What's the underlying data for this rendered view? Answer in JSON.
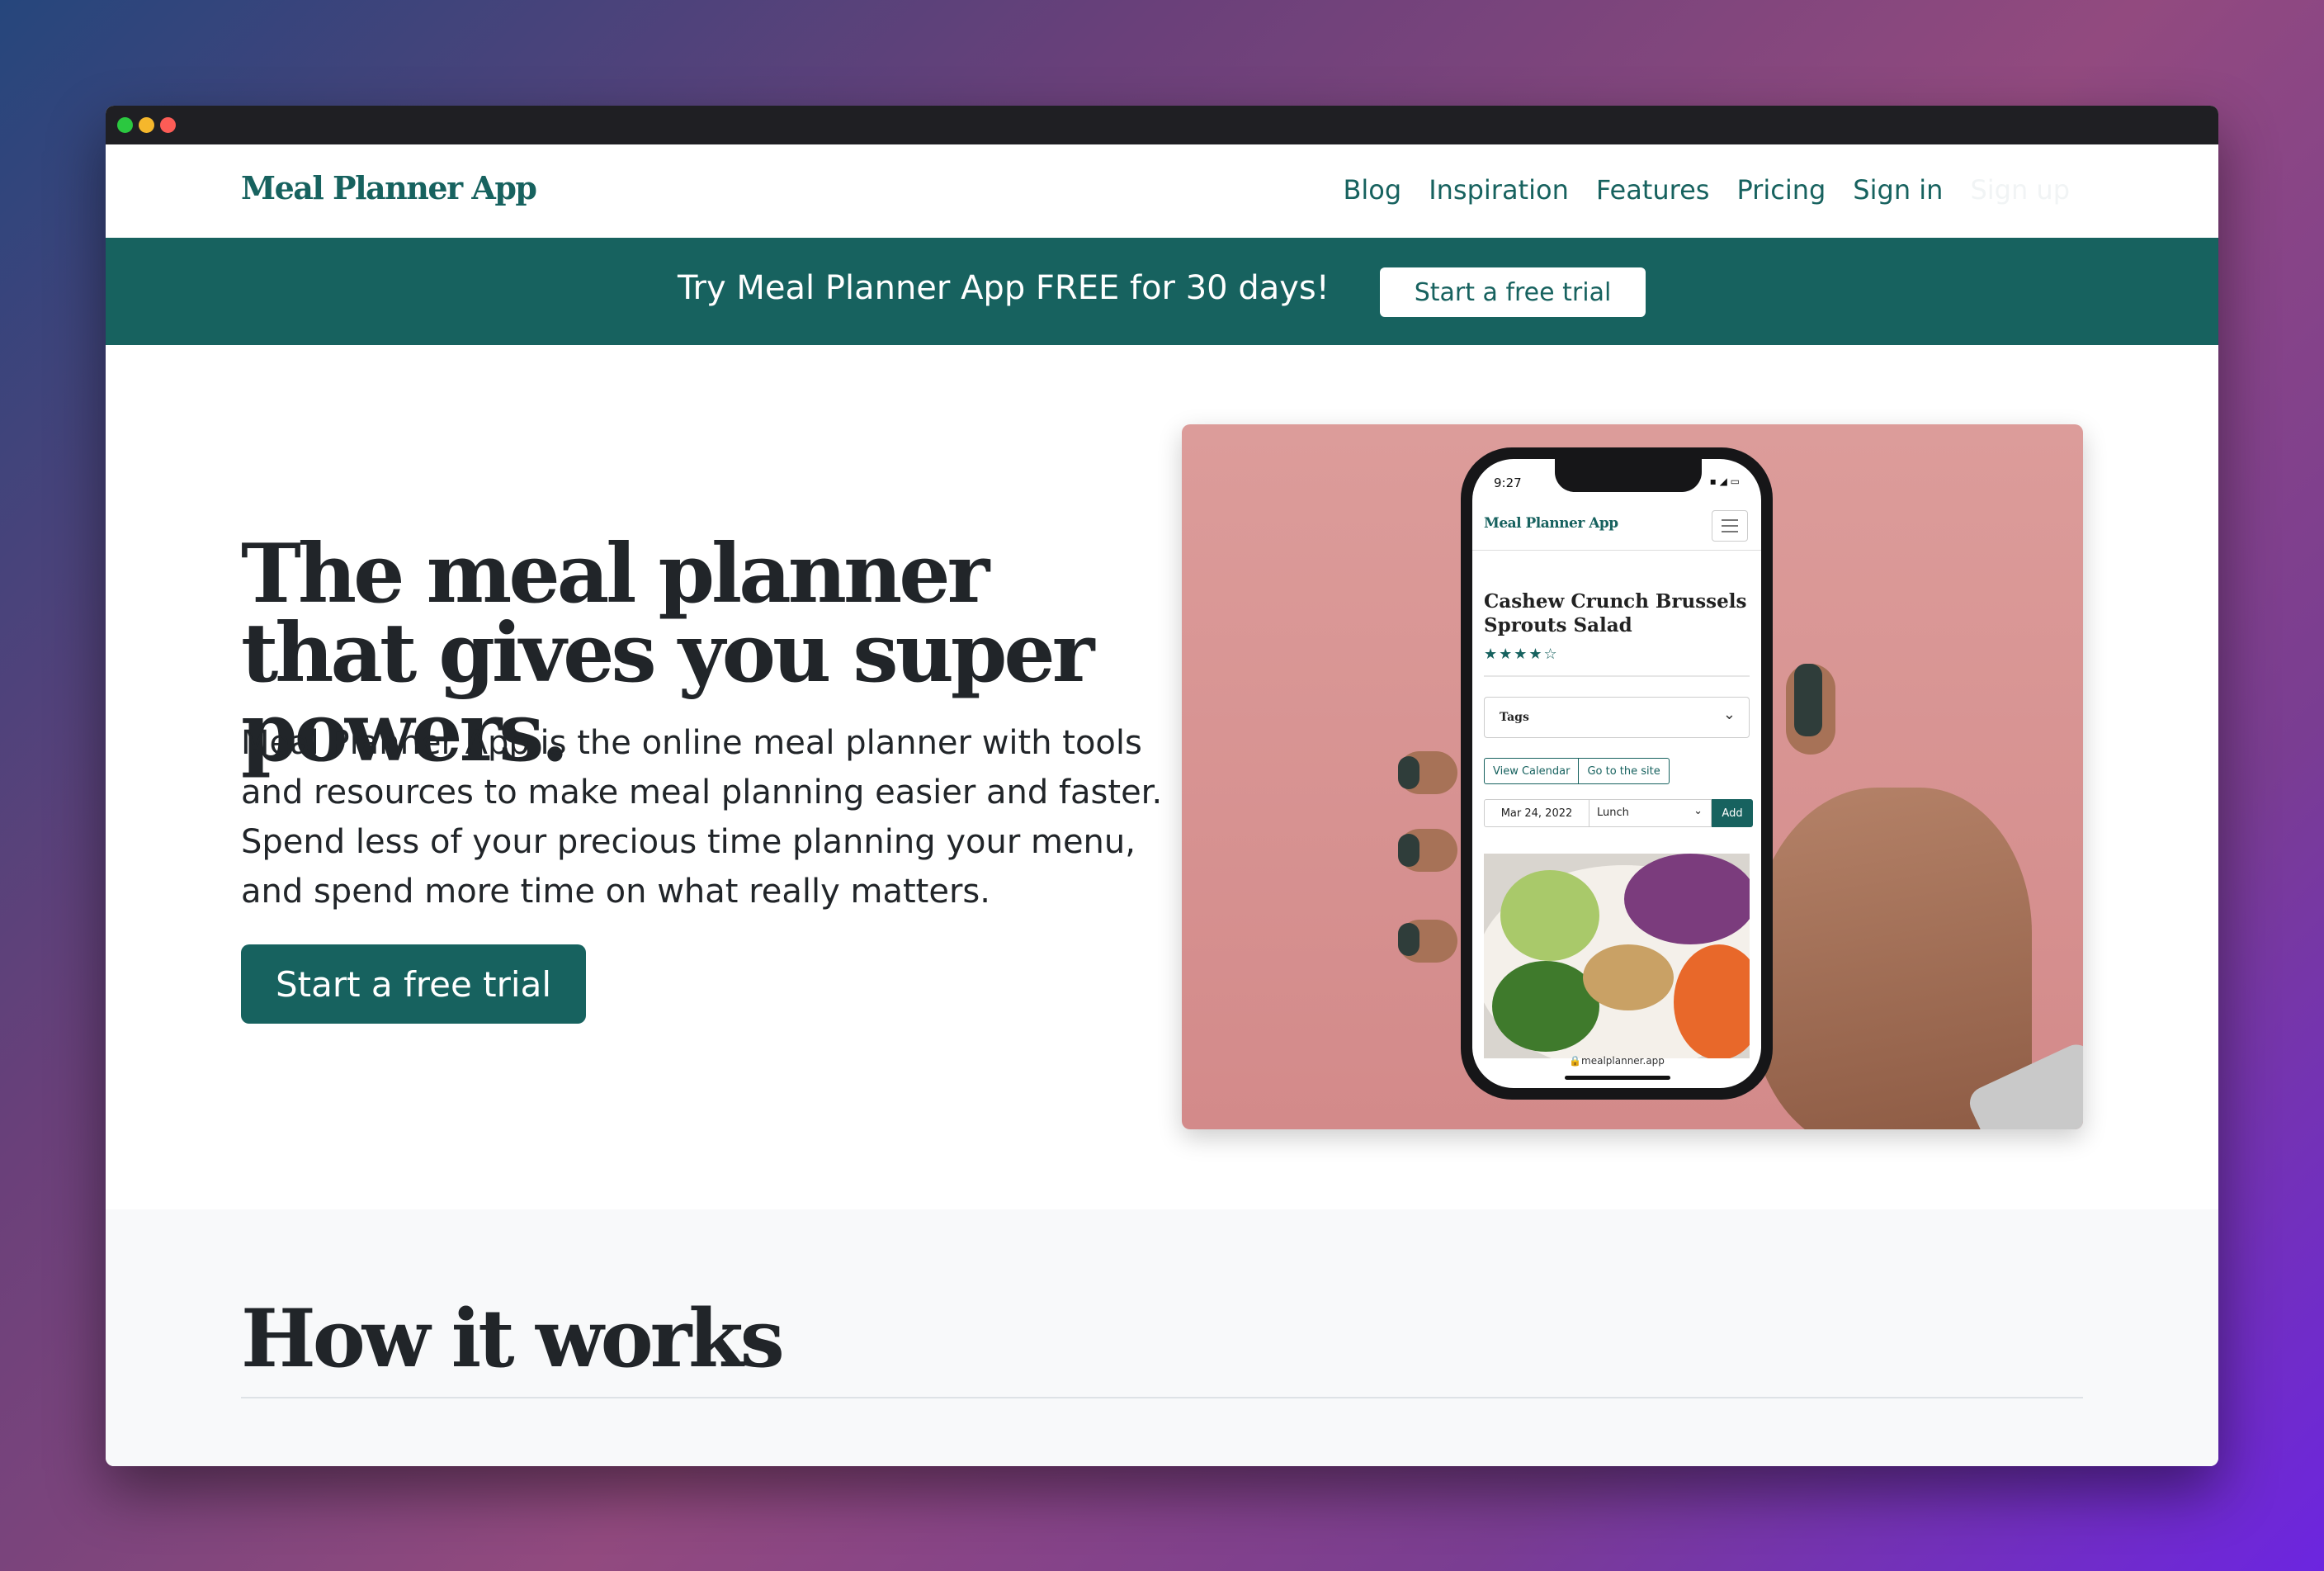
{
  "window": {
    "controls": [
      "green",
      "yellow",
      "red"
    ]
  },
  "navbar": {
    "brand": "Meal Planner App",
    "links": [
      {
        "label": "Blog"
      },
      {
        "label": "Inspiration"
      },
      {
        "label": "Features"
      },
      {
        "label": "Pricing"
      },
      {
        "label": "Sign in"
      },
      {
        "label": "Sign up"
      }
    ]
  },
  "banner": {
    "text": "Try Meal Planner App FREE for 30 days!",
    "button_label": "Start a free trial"
  },
  "hero": {
    "title": "The meal planner that gives you super powers.",
    "description": "Meal Planner App is the online meal planner with tools and resources to make meal planning easier and faster. Spend less of your precious time planning your menu, and spend more time on what really matters.",
    "button_label": "Start a free trial"
  },
  "phone": {
    "time": "9:27",
    "status_icons": "▪ ◢ ▭",
    "brand": "Meal Planner App",
    "recipe_title": "Cashew Crunch Brussels Sprouts Salad",
    "rating": 4,
    "stars": "★★★★☆",
    "tags_label": "Tags",
    "view_calendar": "View Calendar",
    "go_to_site": "Go to the site",
    "date": "Mar 24, 2022",
    "meal": "Lunch",
    "add_label": "Add",
    "url": "🔒mealplanner.app"
  },
  "how_it_works": {
    "title": "How it works"
  },
  "colors": {
    "brand": "#17625f",
    "text": "#212529",
    "image_bg": "#d8908f"
  }
}
